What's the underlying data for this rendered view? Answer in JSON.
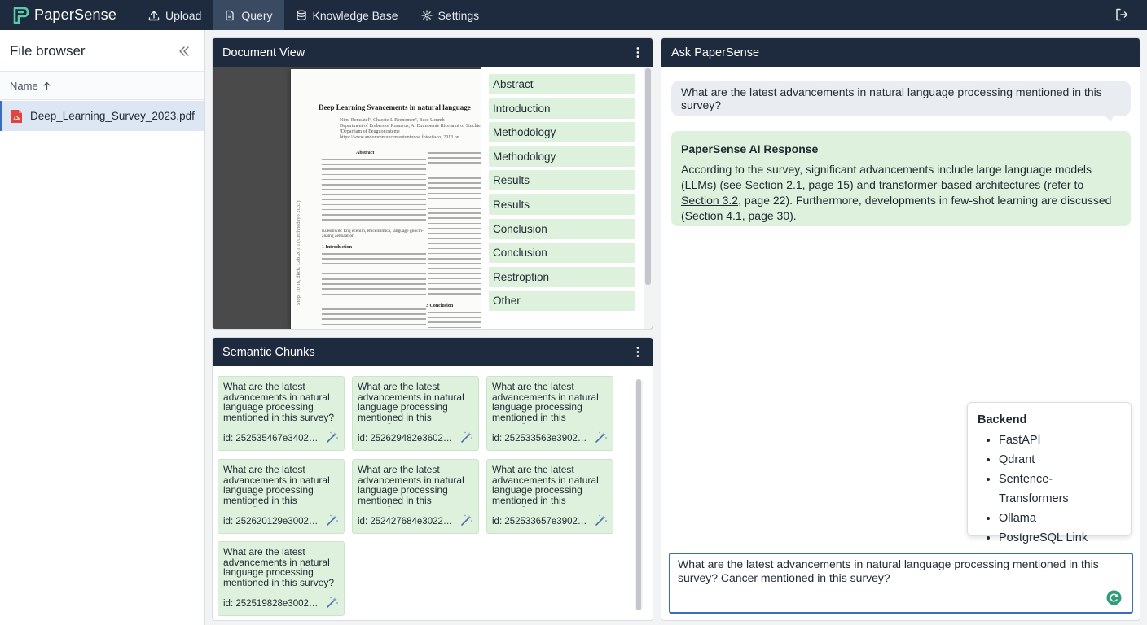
{
  "app": {
    "name": "PaperSense"
  },
  "nav": {
    "items": [
      {
        "label": "Upload",
        "icon": "upload-icon",
        "active": false
      },
      {
        "label": "Query",
        "icon": "document-icon",
        "active": true
      },
      {
        "label": "Knowledge Base",
        "icon": "database-icon",
        "active": false
      },
      {
        "label": "Settings",
        "icon": "gear-icon",
        "active": false
      }
    ]
  },
  "sidebar": {
    "title": "File browser",
    "column_header": "Name",
    "sort": "ascending",
    "files": [
      {
        "name": "Deep_Learning_Survey_2023.pdf",
        "selected": true
      }
    ]
  },
  "document_view": {
    "title": "Document View",
    "page": {
      "title": "Deep Learning Svancements in natural language",
      "authors": "Nimi Remsatel¹, Chaosto L Reenomen², Bece Uenmh\nDepartment of Ereberstor Rumarus, Al Emmoemte Ricenamt of Stnchiemes\n¹Departiam of Eeuguoncnteme\nhttps://www.andommmuncementuntunoe foteatiaco, 2013 on",
      "abstract_heading": "Abstract",
      "keywords": "Kuesmwik: Eng ecenim, emcelilimica, language gnocm- anaing aenoaation",
      "intro_heading": "1   Introduction",
      "conclusion_heading": "3   Conclusion",
      "side_note": "Stopl 10 16, dkch. Leb.201 1 (Cnchnedayo 2033)"
    },
    "toc": [
      "Abstract",
      "Introduction",
      "Methodology",
      "Methodology",
      "Results",
      "Results",
      "Conclusion",
      "Conclusion",
      "Restroption",
      "Other"
    ]
  },
  "chunks": {
    "title": "Semantic Chunks",
    "items": [
      {
        "text": "What are the latest advancements in natural language processing mentioned in this survey?",
        "id": "id: 252535467e340259..."
      },
      {
        "text": "What are the latest advancements in natural language processing mentioned in this survey?...",
        "id": "id: 252629482e360255..."
      },
      {
        "text": "What are the latest advancements in natural language processing mentioned in this survey?...",
        "id": "id: 252533563e390278..."
      },
      {
        "text": "What are the latest advancements in natural language processing mentioned in this survey?...",
        "id": "id: 252620129e300219..."
      },
      {
        "text": "What are the latest advancements in natural language processing mentioned in this survey?...",
        "id": "id: 252427684e302245..."
      },
      {
        "text": "What are the latest advancements in natural language processing mentioned in this survey?...",
        "id": "id: 252533657e390278..."
      },
      {
        "text": "What are the latest advancements in natural language processing mentioned in this survey?",
        "id": "id: 252519828e300288..."
      }
    ]
  },
  "ask": {
    "title": "Ask PaperSense",
    "question": "What are the latest advancements in natural language processing mentioned in this survey?",
    "response_title": "PaperSense AI Response",
    "response": {
      "p1": "According to the survey, significant advancements include large language models (LLMs) (see ",
      "link1": "Section 2.1",
      "p2": ", page 15) and transformer-based architectures (refer to ",
      "link2": "Section 3.2",
      "p3": ", page 22). Furthermore, developments in few-shot learning are discussed (",
      "link3": "Section 4.1",
      "p4": ", page 30)."
    },
    "backend": {
      "title": "Backend",
      "items": [
        "FastAPI",
        "Qdrant",
        "Sentence-Transformers",
        "Ollama",
        "PostgreSQL Link"
      ]
    },
    "input_value": "What are the latest advancements in natural language processing mentioned in this survey? Cancer mentioned in this survey?"
  },
  "colors": {
    "nav_bg": "#1e2b3f",
    "nav_active": "#3a4a61",
    "chip_green": "#ddf1dc",
    "accent_blue": "#3c6cc0",
    "brand_green": "#5cc9a7",
    "pdf_red": "#e0443e"
  }
}
